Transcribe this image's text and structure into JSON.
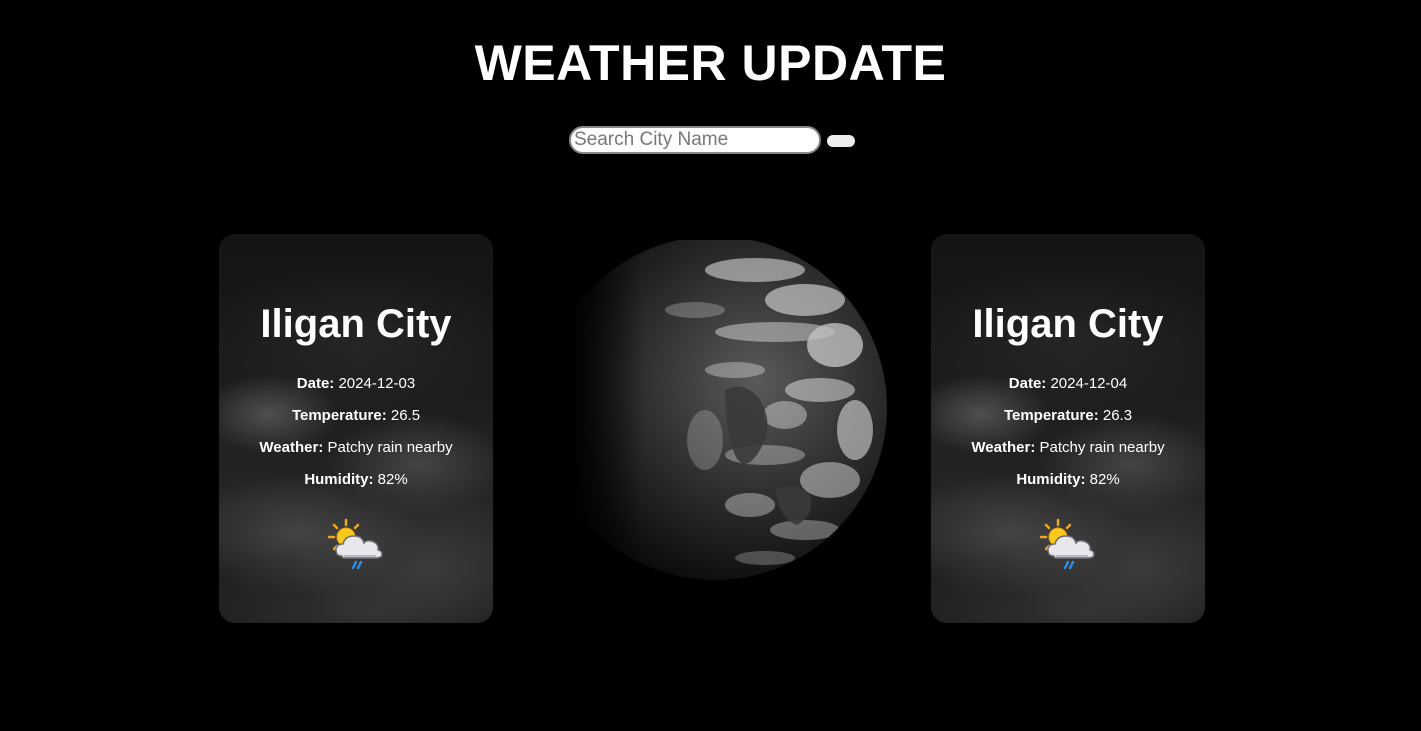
{
  "header": {
    "title": "WEATHER UPDATE"
  },
  "search": {
    "placeholder": "Search City Name",
    "value": "",
    "button_label": ""
  },
  "cards": [
    {
      "city": "Iligan City",
      "date_label": "Date:",
      "date": "2024-12-03",
      "temperature_label": "Temperature:",
      "temperature": "26.5",
      "weather_label": "Weather:",
      "weather": "Patchy rain nearby",
      "humidity_label": "Humidity:",
      "humidity": "82%",
      "icon": "sun-cloud-rain-icon"
    },
    {
      "city": "Iligan City",
      "date_label": "Date:",
      "date": "2024-12-04",
      "temperature_label": "Temperature:",
      "temperature": "26.3",
      "weather_label": "Weather:",
      "weather": "Patchy rain nearby",
      "humidity_label": "Humidity:",
      "humidity": "82%",
      "icon": "sun-cloud-rain-icon"
    }
  ],
  "center_image": {
    "icon": "earth-globe-image"
  },
  "colors": {
    "background": "#000000",
    "text": "#ffffff",
    "sun": "#f5c518",
    "rain": "#2f8fe0"
  }
}
